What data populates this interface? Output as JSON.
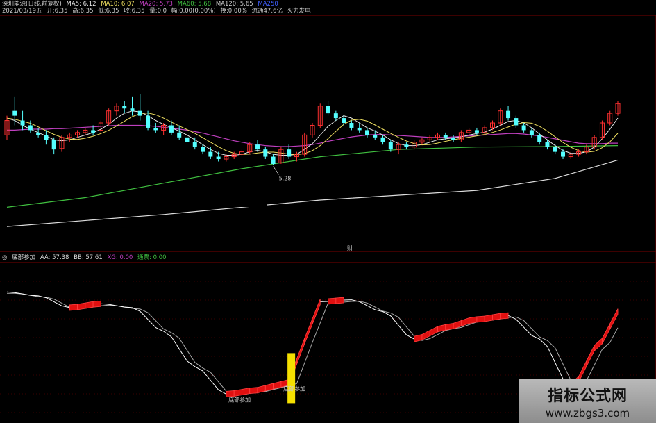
{
  "header": {
    "line1": {
      "title": "深圳能源(日线,前复权)",
      "ma5": "MA5: 6.12",
      "ma10": "MA10: 6.07",
      "ma20": "MA20: 5.73",
      "ma60": "MA60: 5.68",
      "ma120": "MA120: 5.65",
      "ma250": "MA250"
    },
    "line2": {
      "date": "2021/03/19五",
      "open": "开:6.35",
      "high": "高:6.35",
      "low": "低:6.35",
      "close": "收:6.35",
      "vol": "量:0.0",
      "change": "幅:0.00(0.00%)",
      "turnover": "换:0.00%",
      "float": "流通47.6亿",
      "sector": "火力发电"
    }
  },
  "indicator_header": {
    "name": "底部参加",
    "aa": "AA: 57.38",
    "bb": "BB: 57.61",
    "xg": "XG: 0.00",
    "tp": "通票: 0.00"
  },
  "annotations": {
    "low_price": "5.28",
    "cursor_label": "财",
    "signal_left": "底部参加",
    "signal_right": "底部参加"
  },
  "watermark": {
    "title": "指标公式网",
    "url": "www.zbgs3.com"
  },
  "colors": {
    "bg": "#000000",
    "up_candle": "#ff3030",
    "down_candle": "#54ffff",
    "ma5": "#e8e8e8",
    "ma10": "#f0e060",
    "ma20": "#c040c0",
    "ma60": "#40c040",
    "ma250": "#dddddd",
    "grid": "#7a0000",
    "signal_bar": "#f5e000",
    "aa_line": "#ffffff",
    "fill": "#e01010"
  },
  "chart_data": [
    {
      "type": "candlestick",
      "title": "深圳能源(日线,前复权)",
      "ylabel": "",
      "xlabel": "",
      "annotations": [
        "5.28"
      ],
      "series_names": [
        "MA5",
        "MA10",
        "MA20",
        "MA60",
        "MA120"
      ],
      "ma_last": {
        "MA5": 6.12,
        "MA10": 6.07,
        "MA20": 5.73,
        "MA60": 5.68,
        "MA120": 5.65
      },
      "ohlc": [
        [
          5.9,
          6.3,
          5.8,
          6.2
        ],
        [
          6.4,
          6.7,
          6.1,
          6.3
        ],
        [
          6.2,
          6.4,
          6.0,
          6.1
        ],
        [
          6.1,
          6.2,
          5.95,
          6.0
        ],
        [
          5.95,
          6.05,
          5.85,
          5.9
        ],
        [
          5.9,
          6.0,
          5.7,
          5.8
        ],
        [
          5.8,
          5.85,
          5.5,
          5.6
        ],
        [
          5.62,
          5.9,
          5.55,
          5.85
        ],
        [
          5.85,
          5.95,
          5.75,
          5.9
        ],
        [
          5.9,
          6.0,
          5.85,
          5.95
        ],
        [
          5.95,
          6.05,
          5.9,
          6.0
        ],
        [
          6.0,
          6.1,
          5.9,
          5.95
        ],
        [
          6.0,
          6.2,
          5.95,
          6.15
        ],
        [
          6.15,
          6.45,
          6.1,
          6.4
        ],
        [
          6.4,
          6.55,
          6.3,
          6.5
        ],
        [
          6.5,
          6.6,
          6.35,
          6.45
        ],
        [
          6.45,
          6.7,
          6.3,
          6.4
        ],
        [
          6.4,
          6.75,
          6.2,
          6.3
        ],
        [
          6.3,
          6.4,
          6.0,
          6.05
        ],
        [
          6.05,
          6.15,
          5.95,
          6.0
        ],
        [
          6.0,
          6.15,
          5.9,
          6.1
        ],
        [
          6.1,
          6.2,
          5.9,
          5.95
        ],
        [
          5.95,
          6.1,
          5.8,
          5.85
        ],
        [
          5.85,
          5.95,
          5.7,
          5.75
        ],
        [
          5.75,
          5.85,
          5.6,
          5.65
        ],
        [
          5.65,
          5.7,
          5.5,
          5.55
        ],
        [
          5.55,
          5.65,
          5.4,
          5.45
        ],
        [
          5.45,
          5.55,
          5.35,
          5.4
        ],
        [
          5.4,
          5.5,
          5.35,
          5.45
        ],
        [
          5.45,
          5.55,
          5.4,
          5.5
        ],
        [
          5.5,
          5.6,
          5.45,
          5.55
        ],
        [
          5.55,
          5.75,
          5.5,
          5.7
        ],
        [
          5.7,
          5.8,
          5.55,
          5.6
        ],
        [
          5.6,
          5.65,
          5.4,
          5.45
        ],
        [
          5.45,
          5.5,
          5.28,
          5.3
        ],
        [
          5.32,
          5.65,
          5.3,
          5.6
        ],
        [
          5.6,
          5.7,
          5.4,
          5.45
        ],
        [
          5.45,
          5.55,
          5.35,
          5.5
        ],
        [
          5.5,
          5.95,
          5.45,
          5.9
        ],
        [
          5.9,
          6.15,
          5.85,
          6.1
        ],
        [
          6.1,
          6.55,
          6.05,
          6.5
        ],
        [
          6.5,
          6.6,
          6.3,
          6.35
        ],
        [
          6.35,
          6.4,
          6.2,
          6.25
        ],
        [
          6.25,
          6.3,
          6.1,
          6.15
        ],
        [
          6.15,
          6.2,
          6.0,
          6.05
        ],
        [
          6.05,
          6.15,
          5.95,
          6.0
        ],
        [
          6.0,
          6.05,
          5.85,
          5.9
        ],
        [
          5.9,
          6.0,
          5.8,
          5.85
        ],
        [
          5.85,
          5.9,
          5.7,
          5.75
        ],
        [
          5.75,
          5.8,
          5.55,
          5.6
        ],
        [
          5.6,
          5.75,
          5.5,
          5.7
        ],
        [
          5.7,
          5.75,
          5.6,
          5.65
        ],
        [
          5.65,
          5.8,
          5.6,
          5.75
        ],
        [
          5.75,
          5.85,
          5.7,
          5.8
        ],
        [
          5.8,
          5.9,
          5.75,
          5.85
        ],
        [
          5.85,
          5.95,
          5.8,
          5.9
        ],
        [
          5.9,
          5.95,
          5.8,
          5.85
        ],
        [
          5.85,
          5.9,
          5.75,
          5.8
        ],
        [
          5.8,
          6.0,
          5.75,
          5.95
        ],
        [
          5.95,
          6.05,
          5.9,
          6.0
        ],
        [
          6.0,
          6.05,
          5.9,
          5.95
        ],
        [
          5.95,
          6.1,
          5.9,
          6.05
        ],
        [
          6.05,
          6.2,
          6.0,
          6.15
        ],
        [
          6.15,
          6.45,
          6.1,
          6.4
        ],
        [
          6.4,
          6.5,
          6.2,
          6.25
        ],
        [
          6.25,
          6.3,
          6.05,
          6.1
        ],
        [
          6.1,
          6.15,
          5.95,
          6.0
        ],
        [
          6.0,
          6.05,
          5.85,
          5.9
        ],
        [
          5.9,
          5.95,
          5.7,
          5.75
        ],
        [
          5.75,
          5.8,
          5.6,
          5.65
        ],
        [
          5.65,
          5.7,
          5.5,
          5.55
        ],
        [
          5.55,
          5.6,
          5.4,
          5.45
        ],
        [
          5.45,
          5.55,
          5.4,
          5.5
        ],
        [
          5.5,
          5.6,
          5.45,
          5.55
        ],
        [
          5.55,
          5.7,
          5.5,
          5.65
        ],
        [
          5.65,
          5.9,
          5.6,
          5.85
        ],
        [
          5.85,
          6.2,
          5.8,
          6.15
        ],
        [
          6.15,
          6.4,
          6.1,
          6.35
        ],
        [
          6.35,
          6.6,
          6.3,
          6.55
        ]
      ],
      "ma5": [
        6.25,
        6.2,
        6.1,
        6.02,
        5.95,
        5.88,
        5.8,
        5.78,
        5.8,
        5.85,
        5.9,
        5.95,
        6.02,
        6.12,
        6.25,
        6.35,
        6.4,
        6.38,
        6.3,
        6.2,
        6.12,
        6.05,
        5.98,
        5.9,
        5.8,
        5.7,
        5.6,
        5.52,
        5.48,
        5.48,
        5.5,
        5.55,
        5.58,
        5.55,
        5.5,
        5.48,
        5.48,
        5.5,
        5.6,
        5.72,
        5.9,
        6.08,
        6.2,
        6.3,
        6.25,
        6.15,
        6.05,
        5.98,
        5.9,
        5.8,
        5.72,
        5.68,
        5.68,
        5.7,
        5.75,
        5.8,
        5.82,
        5.84,
        5.86,
        5.9,
        5.93,
        5.96,
        6.02,
        6.1,
        6.18,
        6.2,
        6.15,
        6.05,
        5.92,
        5.8,
        5.68,
        5.58,
        5.52,
        5.52,
        5.55,
        5.65,
        5.82,
        6.02,
        6.25
      ],
      "ma20": [
        6.0,
        6.0,
        6.01,
        6.02,
        6.02,
        6.02,
        6.03,
        6.03,
        6.04,
        6.05,
        6.06,
        6.07,
        6.08,
        6.09,
        6.1,
        6.1,
        6.1,
        6.1,
        6.09,
        6.08,
        6.06,
        6.04,
        6.02,
        6.0,
        5.97,
        5.94,
        5.9,
        5.86,
        5.82,
        5.78,
        5.75,
        5.72,
        5.7,
        5.68,
        5.67,
        5.66,
        5.66,
        5.67,
        5.68,
        5.7,
        5.73,
        5.77,
        5.8,
        5.83,
        5.86,
        5.88,
        5.9,
        5.91,
        5.91,
        5.9,
        5.89,
        5.88,
        5.87,
        5.86,
        5.85,
        5.85,
        5.85,
        5.86,
        5.87,
        5.88,
        5.89,
        5.9,
        5.91,
        5.92,
        5.93,
        5.93,
        5.92,
        5.9,
        5.88,
        5.85,
        5.82,
        5.79,
        5.76,
        5.73,
        5.72,
        5.72,
        5.72,
        5.73,
        5.73
      ],
      "ma60_points": [
        [
          0,
          4.4
        ],
        [
          10,
          4.6
        ],
        [
          20,
          4.9
        ],
        [
          30,
          5.2
        ],
        [
          40,
          5.45
        ],
        [
          50,
          5.6
        ],
        [
          60,
          5.65
        ],
        [
          70,
          5.66
        ],
        [
          78,
          5.68
        ]
      ],
      "ma250_points": [
        [
          0,
          4.0
        ],
        [
          20,
          4.25
        ],
        [
          40,
          4.55
        ],
        [
          60,
          4.75
        ],
        [
          70,
          5.0
        ],
        [
          78,
          5.38
        ]
      ]
    },
    {
      "type": "line",
      "title": "底部参加",
      "series": [
        {
          "name": "AA",
          "last": 57.38
        },
        {
          "name": "BB",
          "last": 57.61
        }
      ],
      "x": [
        0,
        4,
        8,
        12,
        16,
        20,
        24,
        28,
        32,
        34,
        36,
        38,
        40,
        44,
        48,
        52,
        56,
        60,
        64,
        68,
        72,
        76,
        78
      ],
      "values": [
        80,
        78,
        72,
        74,
        72,
        60,
        42,
        28,
        30,
        32,
        34,
        55,
        75,
        76,
        70,
        56,
        62,
        66,
        68,
        56,
        32,
        55,
        70
      ],
      "signals": [
        {
          "x": 29,
          "label": "底部参加"
        },
        {
          "x": 36,
          "label": "底部参加"
        }
      ],
      "ylim": [
        20,
        90
      ]
    }
  ]
}
